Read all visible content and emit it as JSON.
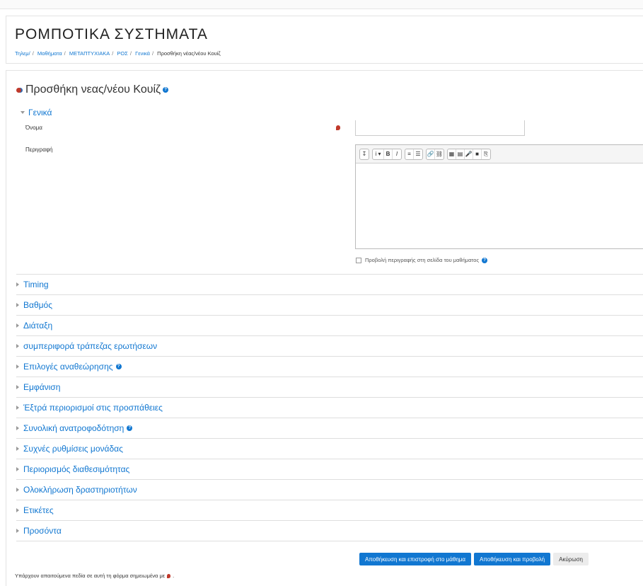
{
  "course": {
    "title": "ΡΟΜΠΟΤΙΚΑ ΣΥΣΤΗΜΑΤΑ"
  },
  "breadcrumb": [
    {
      "label": "Τηλεμ/"
    },
    {
      "label": "Μαθήματα"
    },
    {
      "label": "ΜΕΤΑΠΤΥΧΙΑΚΑ"
    },
    {
      "label": "ΡΟΣ"
    },
    {
      "label": "Γενικά"
    },
    {
      "label": "Προσθήκη νέας/νέου Κουίζ"
    }
  ],
  "page": {
    "heading": "Προσθήκη νεας/νέου Κουίζ"
  },
  "general": {
    "legend": "Γενικά",
    "name_label": "Όνομα",
    "name_value": "",
    "description_label": "Περιγραφή",
    "description_value": "",
    "show_description_label": "Προβολή περιγραφής στη σελίδα του μαθήματος"
  },
  "editor_toolbar": [
    [
      "↧"
    ],
    [
      "i ▾",
      "B",
      "I"
    ],
    [
      "≡",
      "☰"
    ],
    [
      "🔗",
      "⛓"
    ],
    [
      "▦",
      "▤",
      "🎤",
      "■",
      "⎘"
    ]
  ],
  "sections": [
    {
      "label": "Timing",
      "help": false
    },
    {
      "label": "Βαθμός",
      "help": false
    },
    {
      "label": "Διάταξη",
      "help": false
    },
    {
      "label": "συμπεριφορά τράπεζας ερωτήσεων",
      "help": false
    },
    {
      "label": "Επιλογές αναθεώρησης",
      "help": true
    },
    {
      "label": "Εμφάνιση",
      "help": false
    },
    {
      "label": "Έξτρά περιορισμοί στις προσπάθειες",
      "help": false
    },
    {
      "label": "Συνολική ανατροφοδότηση",
      "help": true
    },
    {
      "label": "Συχνές ρυθμίσεις μονάδας",
      "help": false
    },
    {
      "label": "Περιορισμός διαθεσιμότητας",
      "help": false
    },
    {
      "label": "Ολοκλήρωση δραστηριοτήτων",
      "help": false
    },
    {
      "label": "Ετικέτες",
      "help": false
    },
    {
      "label": "Προσόντα",
      "help": false
    }
  ],
  "buttons": {
    "save_return": "Αποθήκευση και επιστροφή στο μάθημα",
    "save_display": "Αποθήκευση και προβολή",
    "cancel": "Ακύρωση"
  },
  "footer": {
    "required_note_prefix": "Υπάρχουν απαιτούμενα πεδία σε αυτή τη φόρμα σημειωμένα με",
    "required_note_suffix": "."
  },
  "colors": {
    "link": "#1177d1",
    "required": "#c0392b",
    "primary_button": "#1177d1"
  }
}
